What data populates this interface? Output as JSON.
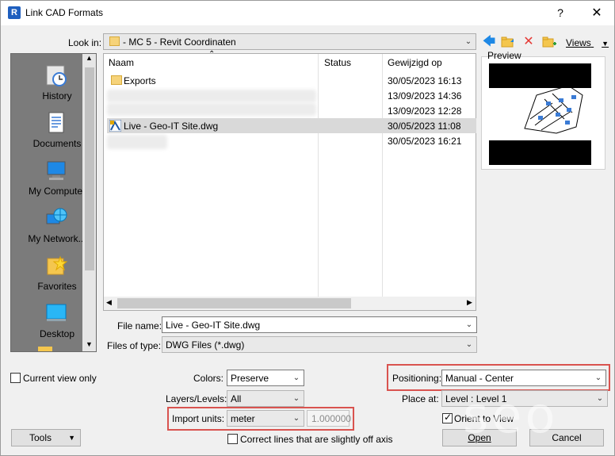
{
  "window": {
    "title": "Link CAD Formats",
    "help_glyph": "?",
    "close_glyph": "✕",
    "app_icon_letter": "R"
  },
  "look_in": {
    "label": "Look in:",
    "value": "- MC 5 - Revit Coordinaten",
    "views_label": "Views"
  },
  "places": [
    {
      "label": "History",
      "icon": "history-icon"
    },
    {
      "label": "Documents",
      "icon": "documents-icon"
    },
    {
      "label": "My Computer",
      "icon": "computer-icon"
    },
    {
      "label": "My Network...",
      "icon": "network-icon"
    },
    {
      "label": "Favorites",
      "icon": "favorites-icon"
    },
    {
      "label": "Desktop",
      "icon": "desktop-icon"
    }
  ],
  "file_list": {
    "columns": {
      "name": "Naam",
      "status": "Status",
      "modified": "Gewijzigd op"
    },
    "rows": [
      {
        "name": "Exports",
        "status": "",
        "modified": "30/05/2023 16:13",
        "type": "folder"
      },
      {
        "name": "",
        "status": "",
        "modified": "13/09/2023 14:36",
        "type": "blurred"
      },
      {
        "name": "",
        "status": "",
        "modified": "13/09/2023 12:28",
        "type": "blurred"
      },
      {
        "name": "Live - Geo-IT Site.dwg",
        "status": "",
        "modified": "30/05/2023 11:08",
        "type": "dwg"
      },
      {
        "name": "",
        "status": "",
        "modified": "30/05/2023 16:21",
        "type": "blurred"
      }
    ]
  },
  "preview": {
    "label": "Preview"
  },
  "file_name": {
    "label": "File name:",
    "value": "Live - Geo-IT Site.dwg"
  },
  "files_of_type": {
    "label": "Files of type:",
    "value": "DWG Files  (*.dwg)"
  },
  "options": {
    "current_view_only": "Current view only",
    "colors_label": "Colors:",
    "colors_value": "Preserve",
    "layers_label": "Layers/Levels:",
    "layers_value": "All",
    "import_units_label": "Import units:",
    "import_units_value": "meter",
    "scale_value": "1.000000",
    "correct_lines": "Correct lines that are slightly off axis",
    "positioning_label": "Positioning:",
    "positioning_value": "Manual - Center",
    "place_at_label": "Place at:",
    "place_at_value": "Level : Level 1",
    "orient_to_view": "Orient to View"
  },
  "buttons": {
    "tools": "Tools",
    "open": "Open",
    "cancel": "Cancel"
  },
  "colors": {
    "highlight": "#d9534f",
    "selection": "#d9d9d9",
    "places_bg": "#7b7b7b"
  }
}
